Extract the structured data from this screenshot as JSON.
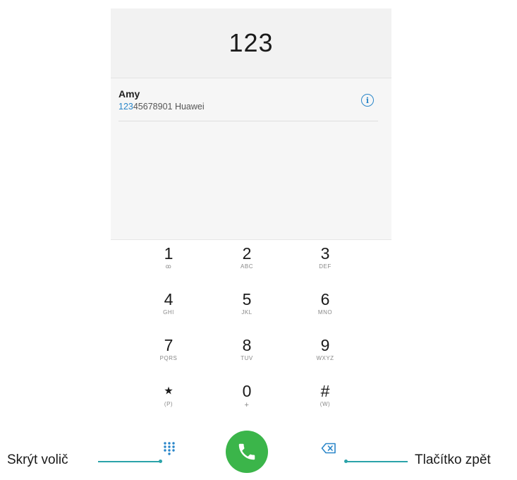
{
  "dialer": {
    "number": "123"
  },
  "contact": {
    "name": "Amy",
    "number_match": "123",
    "number_rest": "45678901",
    "carrier": " Huawei",
    "info_icon": "info-icon"
  },
  "keypad": {
    "keys": [
      {
        "digit": "1",
        "letters": "ꝏ"
      },
      {
        "digit": "2",
        "letters": "ABC"
      },
      {
        "digit": "3",
        "letters": "DEF"
      },
      {
        "digit": "4",
        "letters": "GHI"
      },
      {
        "digit": "5",
        "letters": "JKL"
      },
      {
        "digit": "6",
        "letters": "MNO"
      },
      {
        "digit": "7",
        "letters": "PQRS"
      },
      {
        "digit": "8",
        "letters": "TUV"
      },
      {
        "digit": "9",
        "letters": "WXYZ"
      },
      {
        "digit": "⋆",
        "letters": "(P)"
      },
      {
        "digit": "0",
        "letters": "+"
      },
      {
        "digit": "#",
        "letters": "(W)"
      }
    ]
  },
  "callouts": {
    "hide_dialpad": "Skrýt volič",
    "backspace": "Tlačítko zpět"
  },
  "colors": {
    "accent": "#2a86c9",
    "call_button": "#3bb54a",
    "callout_line": "#2ba3a9"
  }
}
